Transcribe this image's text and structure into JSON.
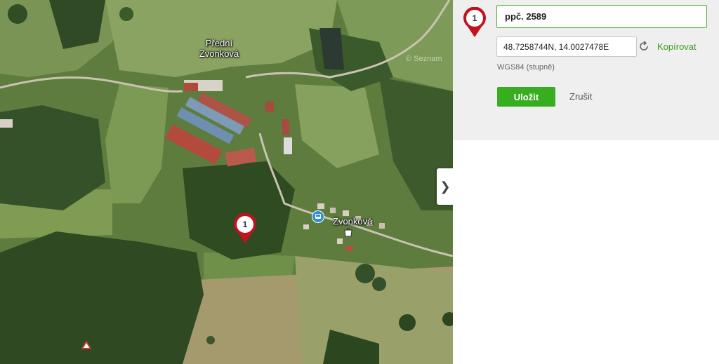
{
  "map": {
    "places": [
      {
        "name": "Přední Zvonková"
      },
      {
        "name": "Zvonková"
      }
    ],
    "watermark": "© Seznam",
    "pin_label": "1",
    "collapse_icon": "chevron-right-icon",
    "poi_icons": [
      "bus-stop-icon",
      "shop-icon",
      "peak-triangle-icon"
    ]
  },
  "panel": {
    "pin_label": "1",
    "name_value": "ppč. 2589",
    "coordinates_value": "48.7258744N, 14.0027478E",
    "copy_label": "Kopírovat",
    "coordinate_system": "WGS84 (stupně)",
    "save_label": "Uložit",
    "cancel_label": "Zrušit"
  },
  "colors": {
    "accent_green": "#37ad20",
    "pin_red": "#c1121f"
  }
}
